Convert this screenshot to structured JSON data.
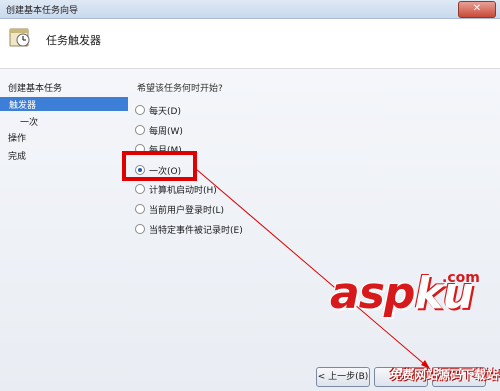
{
  "window": {
    "title": "创建基本任务向导",
    "close_icon": "close-icon"
  },
  "header": {
    "title": "任务触发器",
    "icon": "scheduled-task-icon"
  },
  "sidebar": {
    "items": [
      {
        "label": "创建基本任务",
        "selected": false
      },
      {
        "label": "触发器",
        "selected": true
      },
      {
        "label": "一次",
        "selected": false
      },
      {
        "label": "操作",
        "selected": false
      },
      {
        "label": "完成",
        "selected": false
      }
    ]
  },
  "main": {
    "question": "希望该任务何时开始?",
    "options": [
      {
        "label": "每天(D)",
        "checked": false
      },
      {
        "label": "每周(W)",
        "checked": false
      },
      {
        "label": "每月(M)",
        "checked": false
      },
      {
        "label": "一次(O)",
        "checked": true
      },
      {
        "label": "计算机启动时(H)",
        "checked": false
      },
      {
        "label": "当前用户登录时(L)",
        "checked": false
      },
      {
        "label": "当特定事件被记录时(E)",
        "checked": false
      }
    ]
  },
  "buttons": {
    "back": "< 上一步(B)"
  },
  "annotation": {
    "highlight_color": "#e00000",
    "arrow_color": "#e00000"
  },
  "watermark": {
    "main_a": "asp",
    "main_b": "ku",
    "tld": ".com",
    "sub": "免费网站源码下载站!"
  }
}
